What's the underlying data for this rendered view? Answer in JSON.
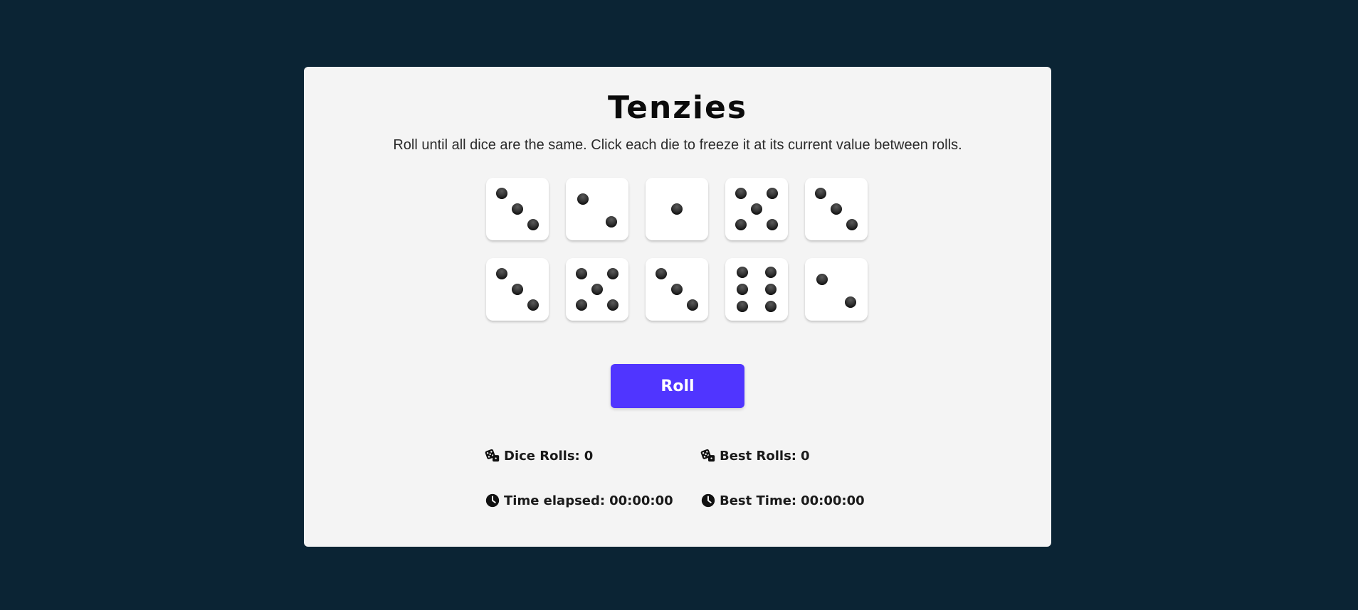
{
  "title": "Tenzies",
  "instructions": "Roll until all dice are the same. Click each die to freeze it at its current value between rolls.",
  "dice": [
    3,
    2,
    1,
    5,
    3,
    3,
    5,
    3,
    6,
    2
  ],
  "roll_button": "Roll",
  "stats": {
    "dice_rolls": {
      "label": "Dice Rolls:",
      "value": "0",
      "icon": "dice-icon"
    },
    "best_rolls": {
      "label": "Best Rolls:",
      "value": "0",
      "icon": "dice-icon"
    },
    "time_elapsed": {
      "label": "Time elapsed:",
      "value": "00:00:00",
      "icon": "clock-icon"
    },
    "best_time": {
      "label": "Best Time:",
      "value": "00:00:00",
      "icon": "clock-icon"
    }
  },
  "colors": {
    "background": "#0b2434",
    "board": "#f4f4f4",
    "button": "#5035ff",
    "die_face": "#ffffff"
  }
}
